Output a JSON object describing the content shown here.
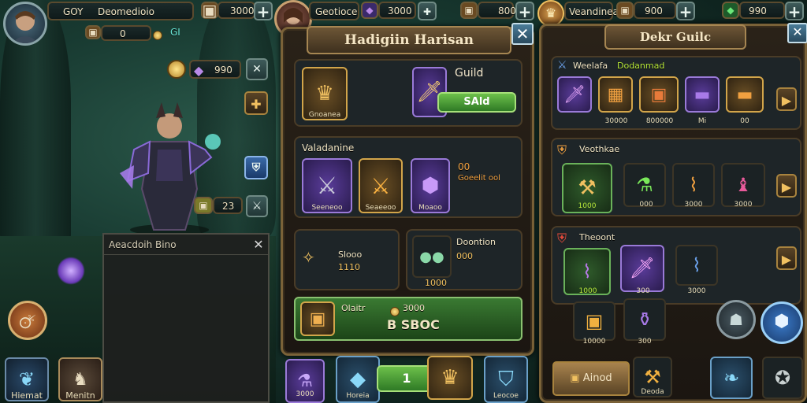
{
  "topbar": {
    "left": {
      "level": "GOY",
      "name": "Deomedioio",
      "res1": "3000",
      "res2": "0",
      "res3": "GI"
    },
    "middle": {
      "name": "Geotioce",
      "res1": "3000",
      "res2": "800"
    },
    "right": {
      "name": "Veandinea",
      "res1": "900",
      "res2": "990"
    }
  },
  "left_hud": {
    "res_a": "990",
    "res_b": "23",
    "chat_title": "Aeacdoih Bino",
    "bottom_a": "Hiemat",
    "bottom_b": "Menitn"
  },
  "center_panel": {
    "title": "Hadigiin Harisan",
    "guild_label": "Guild",
    "featured_label": "Gnoanea",
    "sold_button": "SAld",
    "section2_title": "Valadanine",
    "slot1": "Seeneoo",
    "slot2": "Seaeeoo",
    "slot3": "Moaoo",
    "info1": "00",
    "info2": "Goeelit ool",
    "box_a_label": "Slooo",
    "box_a_value": "1110",
    "box_b_label": "Doontion",
    "box_b_value1": "000",
    "box_b_value2": "1000",
    "chest_label": "Olaitr",
    "chest_value": "3000",
    "chest_total": "B SBOC",
    "bottom_value": "1",
    "bottom_b1": "3000",
    "bottom_b2": "Horeia",
    "bottom_b3": "Leocoe"
  },
  "right_panel": {
    "title": "Dekr Guilc",
    "row1_title": "Weelafa",
    "row1_sub": "Dodanmad",
    "row1_items": [
      "",
      "30000",
      "800000",
      "Mi",
      "00"
    ],
    "row2_title": "Veothkae",
    "row2_items": [
      "1000",
      "000",
      "3000",
      "3000"
    ],
    "row3_title": "Theoont",
    "row3_items": [
      "1000",
      "300",
      "3000"
    ],
    "row4_items": [
      "10000",
      "300"
    ],
    "bottom_button": "Ainod",
    "bottom_label": "Deoda"
  },
  "icons": [
    "avatar",
    "chest-icon",
    "potion-icon",
    "gem-icon",
    "sword-icon",
    "close-icon",
    "plus-icon",
    "arrow-right-icon",
    "shield-icon",
    "crown-icon"
  ]
}
